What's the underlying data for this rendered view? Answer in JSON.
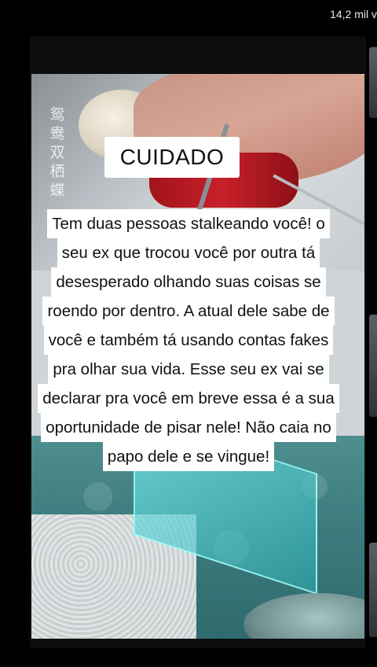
{
  "header": {
    "view_count": "14,2 mil v"
  },
  "video": {
    "watermark": "鸳鸯双栖蝶",
    "title": "CUIDADO",
    "caption_lines": [
      "Tem duas pessoas stalkeando você! o",
      "seu ex que trocou você por outra tá",
      "desesperado olhando suas coisas se",
      "roendo por dentro. A atual dele sabe de",
      "você e também tá usando contas fakes",
      "pra olhar sua vida. Esse seu ex vai se",
      "declarar pra você em breve essa é a sua",
      "oportunidade de pisar nele! Não caia no",
      "papo dele e se vingue!"
    ]
  }
}
